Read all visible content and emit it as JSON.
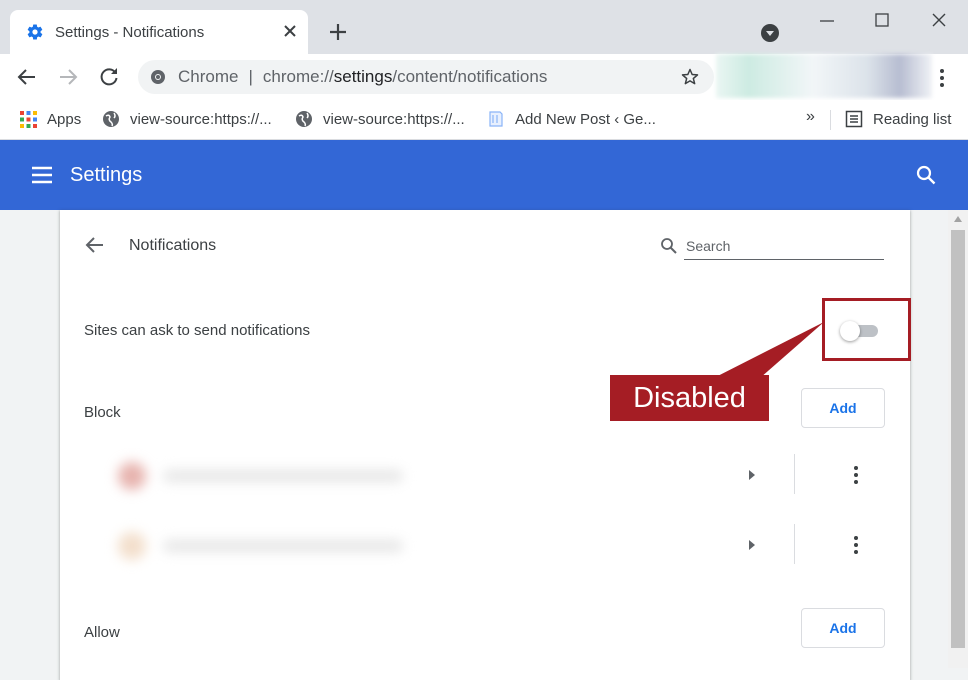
{
  "tab": {
    "title": "Settings - Notifications"
  },
  "toolbar": {
    "chip_label": "Chrome",
    "url_prefix": "chrome://",
    "url_path": "settings",
    "url_suffix": "/content/notifications"
  },
  "bookmarks": {
    "items": [
      {
        "label": "Apps"
      },
      {
        "label": "view-source:https://..."
      },
      {
        "label": "view-source:https://..."
      },
      {
        "label": "Add New Post ‹ Ge..."
      }
    ],
    "overflow": "»",
    "reading_list": "Reading list"
  },
  "settings_header": {
    "title": "Settings"
  },
  "page": {
    "title": "Notifications",
    "search_placeholder": "Search",
    "toggle_row_label": "Sites can ask to send notifications",
    "toggle_enabled": false,
    "block_label": "Block",
    "allow_label": "Allow",
    "add_label": "Add"
  },
  "annotation": {
    "label": "Disabled",
    "color": "#a51d24"
  },
  "colors": {
    "header": "#3367d6",
    "link": "#1a73e8"
  }
}
